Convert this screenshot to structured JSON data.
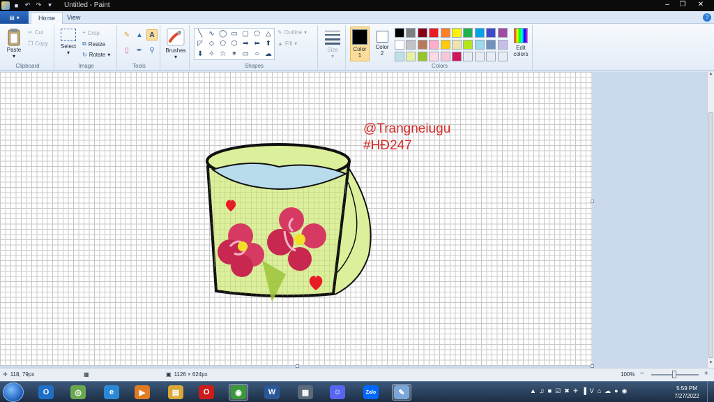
{
  "window": {
    "title": "Untitled - Paint",
    "minimize_glyph": "–",
    "maximize_glyph": "❐",
    "close_glyph": "✕"
  },
  "tabs": {
    "file_glyph": "▾",
    "home": "Home",
    "view": "View",
    "help_glyph": "?"
  },
  "ribbon": {
    "clipboard": {
      "label": "Clipboard",
      "paste": "Paste",
      "cut": "Cut",
      "copy": "Copy"
    },
    "image": {
      "label": "Image",
      "select": "Select",
      "crop": "Crop",
      "resize": "Resize",
      "rotate": "Rotate"
    },
    "tools": {
      "label": "Tools",
      "brushes": "Brushes"
    },
    "shapes": {
      "label": "Shapes",
      "outline": "Outline",
      "fill": "Fill",
      "glyphs": [
        "╲",
        "∿",
        "◯",
        "▭",
        "▢",
        "⬠",
        "△",
        "◸",
        "◇",
        "⬠",
        "⬡",
        "➡",
        "⬅",
        "⬆",
        "⬇",
        "✧",
        "☆",
        "✶",
        "▭",
        "○",
        "☁"
      ]
    },
    "size": {
      "label": "Size"
    },
    "colors": {
      "label": "Colors",
      "color1": "Color\n1",
      "color1_line1": "Color",
      "color1_line2": "1",
      "color2_line1": "Color",
      "color2_line2": "2",
      "color1_value": "#000000",
      "color2_value": "#ffffff",
      "edit_line1": "Edit",
      "edit_line2": "colors",
      "palette_row1": [
        "#000000",
        "#7f7f7f",
        "#880015",
        "#ed1c24",
        "#ff7f27",
        "#fff200",
        "#22b14c",
        "#00a2e8",
        "#3f48cc",
        "#a349a4"
      ],
      "palette_row2": [
        "#ffffff",
        "#c3c3c3",
        "#b97a57",
        "#ffaec9",
        "#ffc90e",
        "#efe4b0",
        "#b5e61d",
        "#99d9ea",
        "#7092be",
        "#c8bfe7"
      ],
      "palette_row3": [
        "#c0e0e8",
        "#e6f0a0",
        "#98c428",
        "#ffd8e6",
        "#f8c8d8",
        "#d4145a",
        "#e8ecf2",
        "#e8ecf2",
        "#e8ecf2",
        "#e8ecf2"
      ]
    }
  },
  "canvas": {
    "watermark_line1": "@Trangneiugu",
    "watermark_line2": "#HĐ247"
  },
  "status": {
    "cursor_pos": "118, 79px",
    "image_size": "1126 × 624px",
    "zoom": "100%",
    "zoom_minus": "−",
    "zoom_plus": "+"
  },
  "taskbar": {
    "apps": [
      {
        "name": "outlook",
        "glyph": "O",
        "color": "#1f6fc7"
      },
      {
        "name": "app-green",
        "glyph": "◎",
        "color": "#6aa84f"
      },
      {
        "name": "internet-explorer",
        "glyph": "e",
        "color": "#2b88d8"
      },
      {
        "name": "media-player",
        "glyph": "▶",
        "color": "#e07b24"
      },
      {
        "name": "file-explorer",
        "glyph": "▤",
        "color": "#d8a838"
      },
      {
        "name": "opera",
        "glyph": "O",
        "color": "#cc1b1b"
      },
      {
        "name": "chrome",
        "glyph": "◉",
        "color": "#3a9a3a"
      },
      {
        "name": "word",
        "glyph": "W",
        "color": "#2b579a"
      },
      {
        "name": "calculator",
        "glyph": "▦",
        "color": "#5a6a7a"
      },
      {
        "name": "discord",
        "glyph": "☺",
        "color": "#5865f2"
      },
      {
        "name": "zalo",
        "glyph": "Zalo",
        "color": "#0068ff"
      },
      {
        "name": "paint",
        "glyph": "✎",
        "color": "#7aa6d8"
      }
    ],
    "tray_glyphs": [
      "▲",
      "♫",
      "■",
      "☑",
      "✖",
      "✳",
      "▐",
      "V",
      "⌂",
      "☁",
      "●",
      "◉"
    ],
    "time": "5:59 PM",
    "date": "7/27/2022"
  }
}
